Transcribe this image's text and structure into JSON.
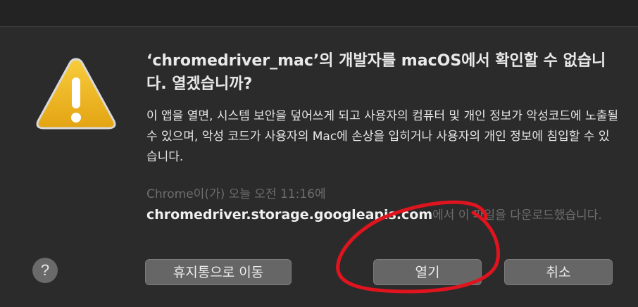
{
  "dialog": {
    "title": "‘chromedriver_mac’의 개발자를 macOS에서 확인할 수 없습니다. 열겠습니까?",
    "message": "이 앱을 열면, 시스템 보안을 덮어쓰게 되고 사용자의 컴퓨터 및 개인 정보가 악성코드에 노출될 수 있으며, 악성 코드가 사용자의 Mac에 손상을 입히거나 사용자의 개인 정보에 침입할 수 있습니다.",
    "source_prefix": "Chrome이(가) 오늘 오전 11:16에",
    "source_host": "chromedriver.storage.googleapis.com",
    "source_suffix": "에서 이 파일을 다운로드했습니다."
  },
  "buttons": {
    "help": "?",
    "move_to_trash": "휴지통으로 이동",
    "open": "열기",
    "cancel": "취소"
  },
  "icons": {
    "warning": "warning-icon",
    "help": "question-icon"
  },
  "colors": {
    "background": "#2b2b2b",
    "annotation": "#e0141e",
    "warning_fill": "#f2b41e"
  }
}
